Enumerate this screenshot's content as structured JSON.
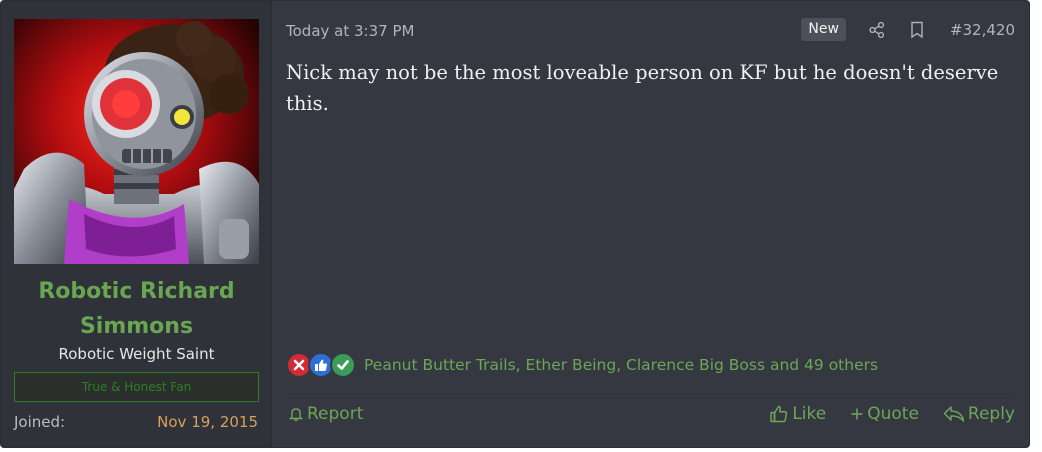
{
  "user": {
    "username": "Robotic Richard Simmons",
    "user_title": "Robotic Weight Saint",
    "banner": "True & Honest Fan",
    "joined_label": "Joined:",
    "joined_value": "Nov 19, 2015"
  },
  "post": {
    "timestamp": "Today at 3:37 PM",
    "new_badge": "New",
    "post_number": "#32,420",
    "message": "Nick may not be the most loveable person on KF but he doesn't deserve this."
  },
  "reactions": {
    "icons": [
      "x-reaction-icon",
      "thumbs-up-reaction-icon",
      "checkmark-reaction-icon"
    ],
    "summary": "Peanut Butter Trails, Ether Being, Clarence Big Boss and 49 others"
  },
  "footer": {
    "report_label": "Report",
    "like_label": "Like",
    "quote_label": "Quote",
    "reply_label": "Reply"
  },
  "colors": {
    "accent_green": "#6ca656",
    "username_green": "#6aa651",
    "joined_date": "#d7a15c",
    "background": "#353840"
  }
}
